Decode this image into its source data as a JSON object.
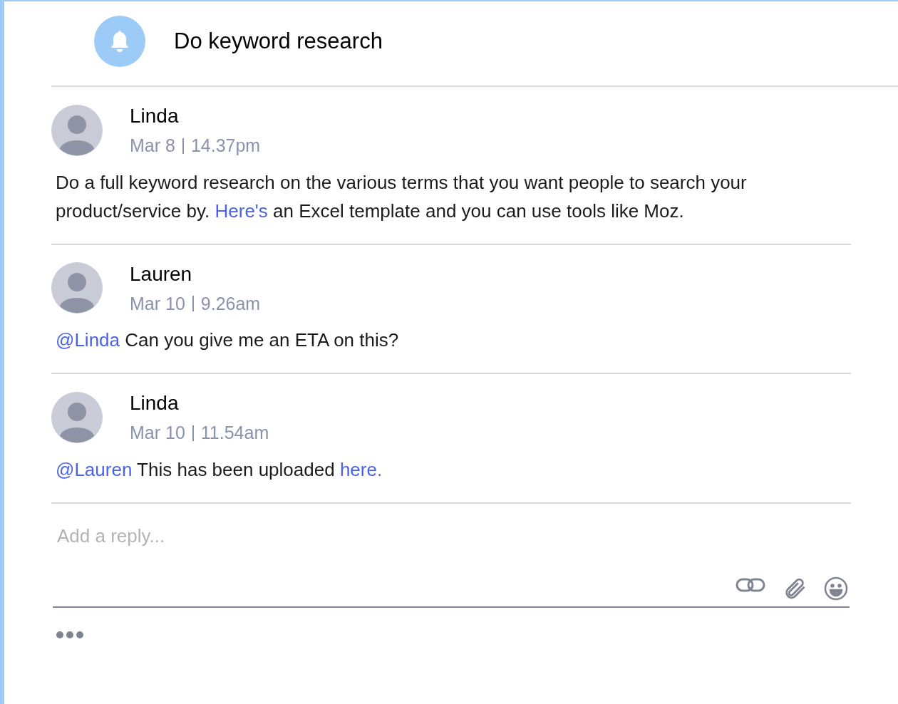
{
  "header": {
    "title": "Do keyword research"
  },
  "comments": [
    {
      "author": "Linda",
      "date": "Mar 8",
      "time": "14.37pm",
      "body": [
        {
          "kind": "text",
          "text": "Do a full keyword research on the various terms that you want people to search your product/service by. "
        },
        {
          "kind": "link",
          "text": "Here's"
        },
        {
          "kind": "text",
          "text": " an Excel template and you can use tools like Moz."
        }
      ]
    },
    {
      "author": "Lauren",
      "date": "Mar 10",
      "time": "9.26am",
      "body": [
        {
          "kind": "mention",
          "text": "@Linda"
        },
        {
          "kind": "text",
          "text": " Can you give me an ETA on this?"
        }
      ]
    },
    {
      "author": "Linda",
      "date": "Mar 10",
      "time": "11.54am",
      "body": [
        {
          "kind": "mention",
          "text": "@Lauren"
        },
        {
          "kind": "text",
          "text": " This has been uploaded "
        },
        {
          "kind": "link",
          "text": "here."
        }
      ]
    }
  ],
  "reply": {
    "placeholder": "Add a reply..."
  }
}
